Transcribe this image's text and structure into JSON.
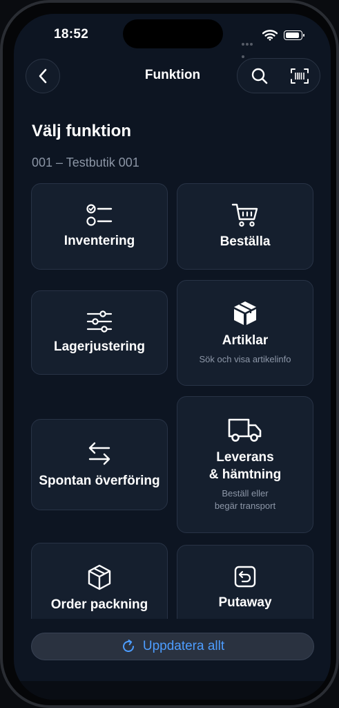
{
  "status": {
    "time": "18:52"
  },
  "nav": {
    "title": "Funktion"
  },
  "page": {
    "title": "Välj funktion",
    "store": "001 – Testbutik 001"
  },
  "functions": [
    {
      "label": "Inventering",
      "icon": "checklist-icon"
    },
    {
      "label": "Beställa",
      "icon": "cart-icon"
    },
    {
      "label": "Lagerjustering",
      "icon": "sliders-icon"
    },
    {
      "label": "Artiklar",
      "icon": "box-icon",
      "subtitle": "Sök och visa artikelinfo"
    },
    {
      "label": "Spontan överföring",
      "icon": "transfer-arrows-icon"
    },
    {
      "label_line1": "Leverans",
      "label_line2": "& hämtning",
      "icon": "truck-icon",
      "subtitle_line1": "Beställ eller",
      "subtitle_line2": "begär transport"
    },
    {
      "label": "Order packning",
      "icon": "package-icon"
    },
    {
      "label": "Putaway",
      "icon": "return-box-icon"
    }
  ],
  "footer": {
    "update_label": "Uppdatera allt"
  },
  "colors": {
    "background": "#0d1522",
    "card": "#151f2e",
    "accent": "#4d9dff"
  }
}
